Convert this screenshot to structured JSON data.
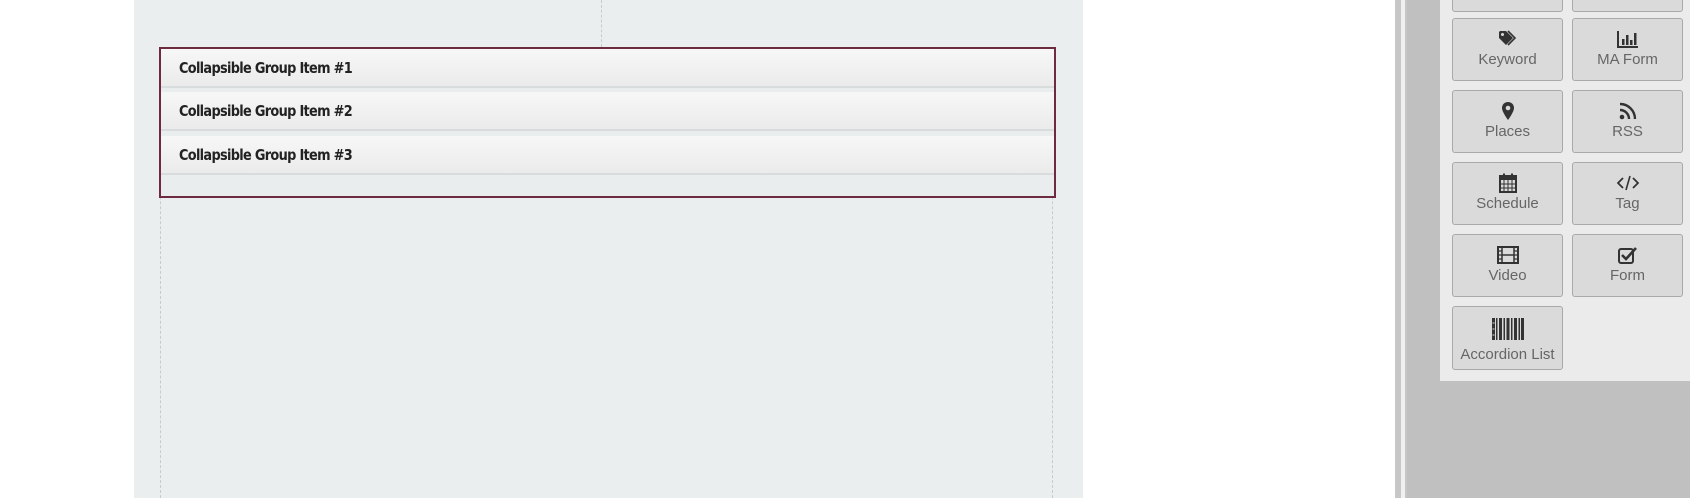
{
  "accordion": {
    "items": [
      {
        "title": "Collapsible Group Item #1"
      },
      {
        "title": "Collapsible Group Item #2"
      },
      {
        "title": "Collapsible Group Item #3"
      }
    ]
  },
  "widgets": {
    "keyword": {
      "label": "Keyword",
      "icon": "tag-icon"
    },
    "ma_form": {
      "label": "MA Form",
      "icon": "bar-chart-icon"
    },
    "places": {
      "label": "Places",
      "icon": "map-marker-icon"
    },
    "rss": {
      "label": "RSS",
      "icon": "rss-icon"
    },
    "schedule": {
      "label": "Schedule",
      "icon": "calendar-icon"
    },
    "tag": {
      "label": "Tag",
      "icon": "code-icon"
    },
    "video": {
      "label": "Video",
      "icon": "film-icon"
    },
    "form": {
      "label": "Form",
      "icon": "checkbox-icon"
    },
    "accordion_list": {
      "label": "Accordion List",
      "icon": "barcode-icon"
    }
  },
  "colors": {
    "accordion_border": "#6e2a3f",
    "canvas_bg": "#ebeeef",
    "panel_bg": "#c0c0c0"
  }
}
